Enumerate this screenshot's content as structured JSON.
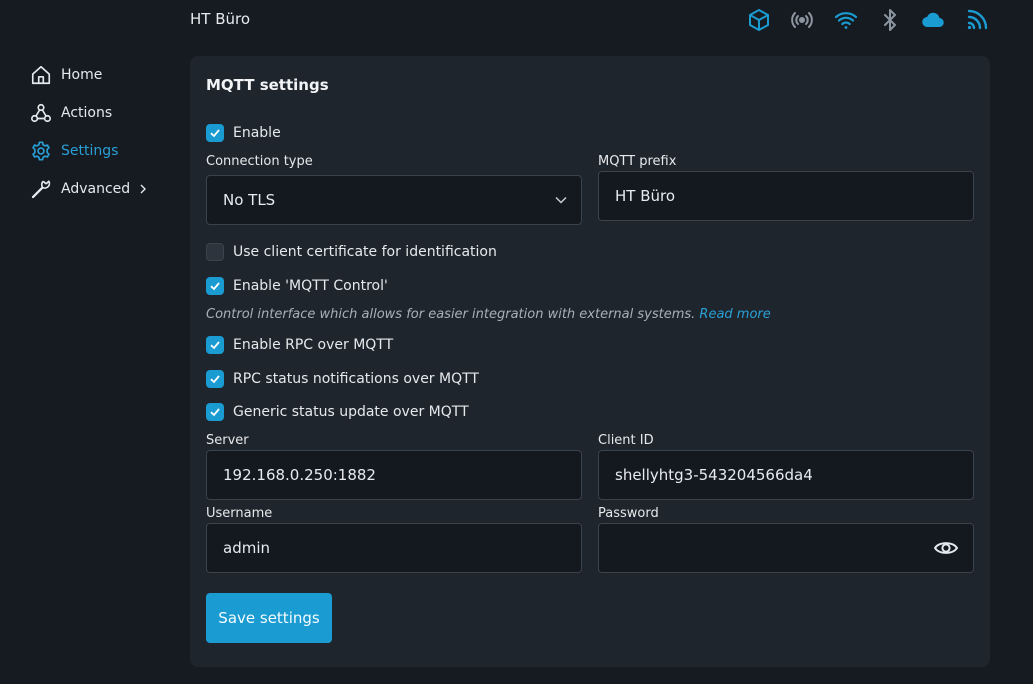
{
  "header": {
    "device_name": "HT Büro",
    "status_icons": [
      "cube-icon",
      "broadcast-icon",
      "wifi-icon",
      "bluetooth-icon",
      "cloud-icon",
      "rss-icon"
    ],
    "accent": "#1a9bd1"
  },
  "sidebar": {
    "items": [
      {
        "label": "Home",
        "icon": "home-icon"
      },
      {
        "label": "Actions",
        "icon": "webhook-icon"
      },
      {
        "label": "Settings",
        "icon": "gear-icon",
        "active": true
      },
      {
        "label": "Advanced",
        "icon": "wrench-icon"
      }
    ]
  },
  "mqtt": {
    "title": "MQTT settings",
    "enable_label": "Enable",
    "enable": true,
    "connection_type_label": "Connection type",
    "connection_type_value": "No TLS",
    "prefix_label": "MQTT prefix",
    "prefix_value": "HT Büro",
    "client_cert_label": "Use client certificate for identification",
    "client_cert": false,
    "mqtt_control_label": "Enable 'MQTT Control'",
    "mqtt_control": true,
    "hint_text": "Control interface which allows for easier integration with external systems.",
    "hint_link": "Read more",
    "rpc_label": "Enable RPC over MQTT",
    "rpc": true,
    "rpc_status_label": "RPC status notifications over MQTT",
    "rpc_status": true,
    "generic_status_label": "Generic status update over MQTT",
    "generic_status": true,
    "server_label": "Server",
    "server_value": "192.168.0.250:1882",
    "client_id_label": "Client ID",
    "client_id_value": "shellyhtg3-543204566da4",
    "username_label": "Username",
    "username_value": "admin",
    "password_label": "Password",
    "password_value": "",
    "save_label": "Save settings"
  }
}
